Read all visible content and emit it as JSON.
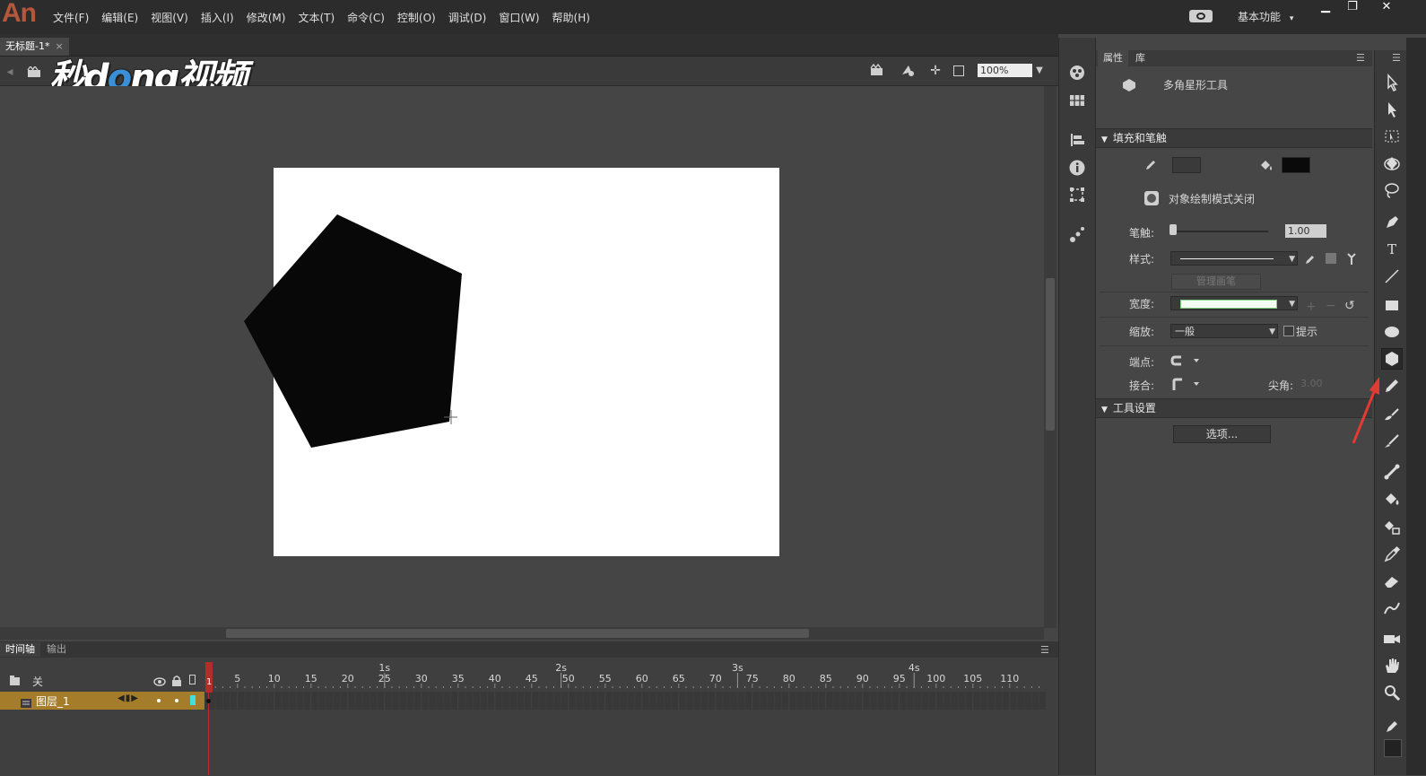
{
  "app": {
    "logo": "An",
    "workspace": "基本功能",
    "workspace_arrow": "▾"
  },
  "menu": [
    "文件(F)",
    "编辑(E)",
    "视图(V)",
    "插入(I)",
    "修改(M)",
    "文本(T)",
    "命令(C)",
    "控制(O)",
    "调试(D)",
    "窗口(W)",
    "帮助(H)"
  ],
  "window_buttons": {
    "minimize": "▁",
    "restore": "❐",
    "close": "✕"
  },
  "document": {
    "tab_title": "无标题-1*",
    "tab_close": "×"
  },
  "watermark": {
    "left": "秒d",
    "o": "o",
    "right": "ng视频"
  },
  "editbar": {
    "zoom": "100%",
    "zoom_arrow": "▼",
    "back": "◂"
  },
  "stage": {
    "background": "#ffffff",
    "shape_fill": "#080808"
  },
  "props": {
    "tabs": [
      "属性",
      "库"
    ],
    "tool_name": "多角星形工具",
    "fill_stroke_header": "填充和笔触",
    "stroke_color": "#3a3a3a",
    "fill_color": "#0a0a0a",
    "object_draw_label": "对象绘制模式关闭",
    "stroke_label": "笔触:",
    "stroke_value": "1.00",
    "style_label": "样式:",
    "manage_brush": "管理画笔",
    "width_label": "宽度:",
    "scale_label": "缩放:",
    "scale_value": "一般",
    "hint_label": "提示",
    "cap_label": "端点:",
    "join_label": "接合:",
    "miter_label": "尖角:",
    "miter_value": "3.00",
    "tool_settings_header": "工具设置",
    "options_button": "选项..."
  },
  "timeline": {
    "tabs": [
      "时间轴",
      "输出"
    ],
    "layer_group_label": "关",
    "layer_name": "图层_1",
    "frame_numbers": [
      "1",
      "5",
      "10",
      "15",
      "20",
      "25",
      "30",
      "35",
      "40",
      "45",
      "50",
      "55",
      "60",
      "65",
      "70",
      "75",
      "80",
      "85",
      "90",
      "95",
      "100",
      "105",
      "110"
    ],
    "second_labels": [
      "1s",
      "2s",
      "3s",
      "4s"
    ]
  },
  "icons": {
    "tools": [
      "selection-icon",
      "subselection-icon",
      "free-transform-icon",
      "3d-rotation-icon",
      "lasso-icon",
      "pen-icon",
      "text-icon",
      "line-icon",
      "rectangle-icon",
      "oval-icon",
      "polystar-icon",
      "pencil-icon",
      "paint-brush-icon",
      "brush-icon",
      "bone-icon",
      "paint-bucket-icon",
      "ink-bottle-icon",
      "eyedropper-icon",
      "eraser-icon",
      "width-icon",
      "camera-icon",
      "hand-icon",
      "zoom-icon",
      "stroke-color-icon",
      "fill-color-icon"
    ]
  },
  "colors": {
    "annotation_arrow": "#e23b32",
    "layer_highlight": "#a47c2a",
    "playhead": "#b32d2d"
  }
}
